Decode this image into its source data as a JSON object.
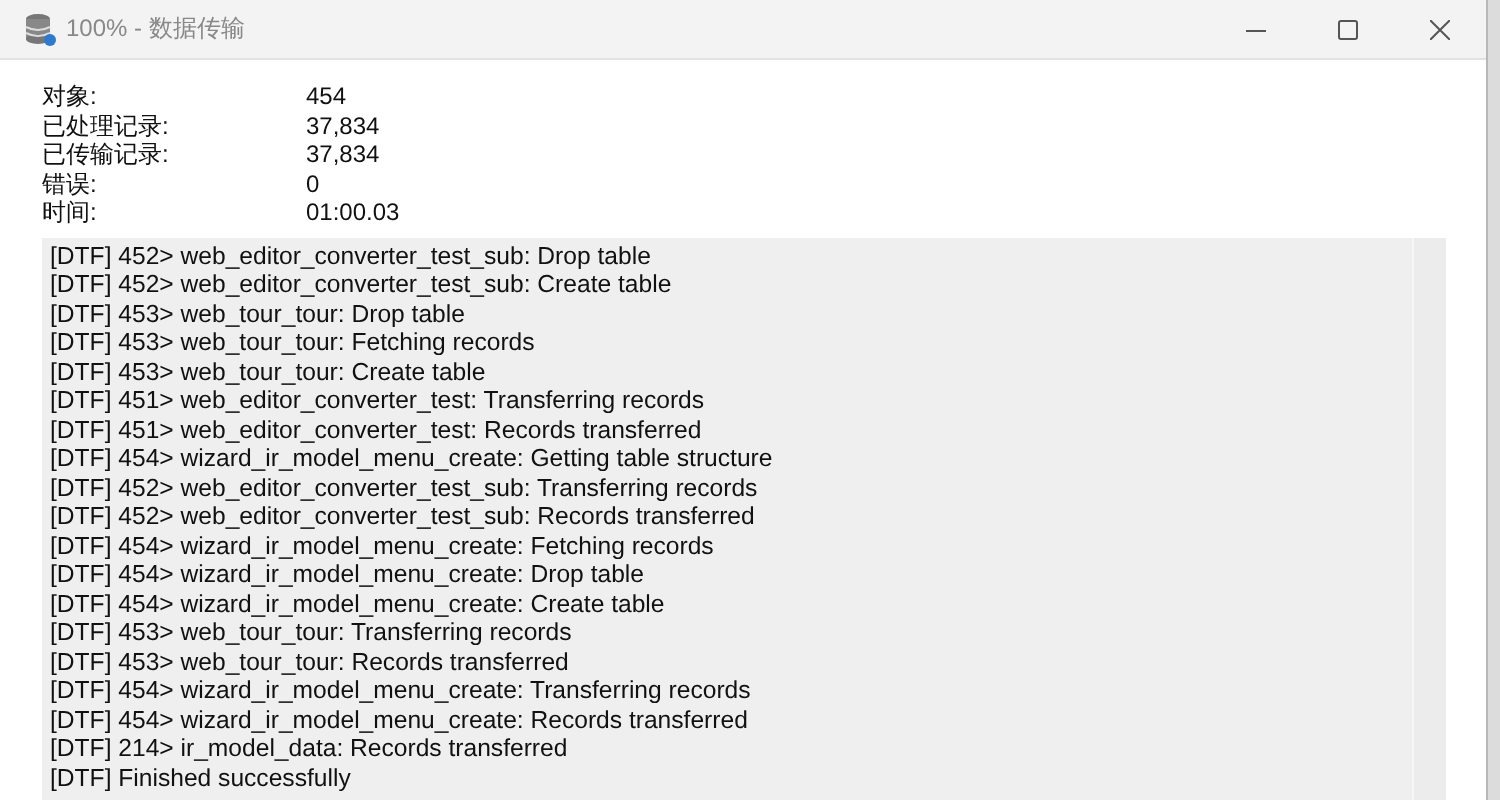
{
  "window": {
    "title": "100% - 数据传输"
  },
  "stats": [
    {
      "label": "对象:",
      "value": "454"
    },
    {
      "label": "已处理记录:",
      "value": "37,834"
    },
    {
      "label": "已传输记录:",
      "value": "37,834"
    },
    {
      "label": "错误:",
      "value": "0"
    },
    {
      "label": "时间:",
      "value": "01:00.03"
    }
  ],
  "log": [
    "[DTF] 452> web_editor_converter_test_sub: Drop table",
    "[DTF] 452> web_editor_converter_test_sub: Create table",
    "[DTF] 453> web_tour_tour: Drop table",
    "[DTF] 453> web_tour_tour: Fetching records",
    "[DTF] 453> web_tour_tour: Create table",
    "[DTF] 451> web_editor_converter_test: Transferring records",
    "[DTF] 451> web_editor_converter_test: Records transferred",
    "[DTF] 454> wizard_ir_model_menu_create: Getting table structure",
    "[DTF] 452> web_editor_converter_test_sub: Transferring records",
    "[DTF] 452> web_editor_converter_test_sub: Records transferred",
    "[DTF] 454> wizard_ir_model_menu_create: Fetching records",
    "[DTF] 454> wizard_ir_model_menu_create: Drop table",
    "[DTF] 454> wizard_ir_model_menu_create: Create table",
    "[DTF] 453> web_tour_tour: Transferring records",
    "[DTF] 453> web_tour_tour: Records transferred",
    "[DTF] 454> wizard_ir_model_menu_create: Transferring records",
    "[DTF] 454> wizard_ir_model_menu_create: Records transferred",
    "[DTF] 214> ir_model_data: Records transferred",
    "[DTF] Finished successfully"
  ]
}
